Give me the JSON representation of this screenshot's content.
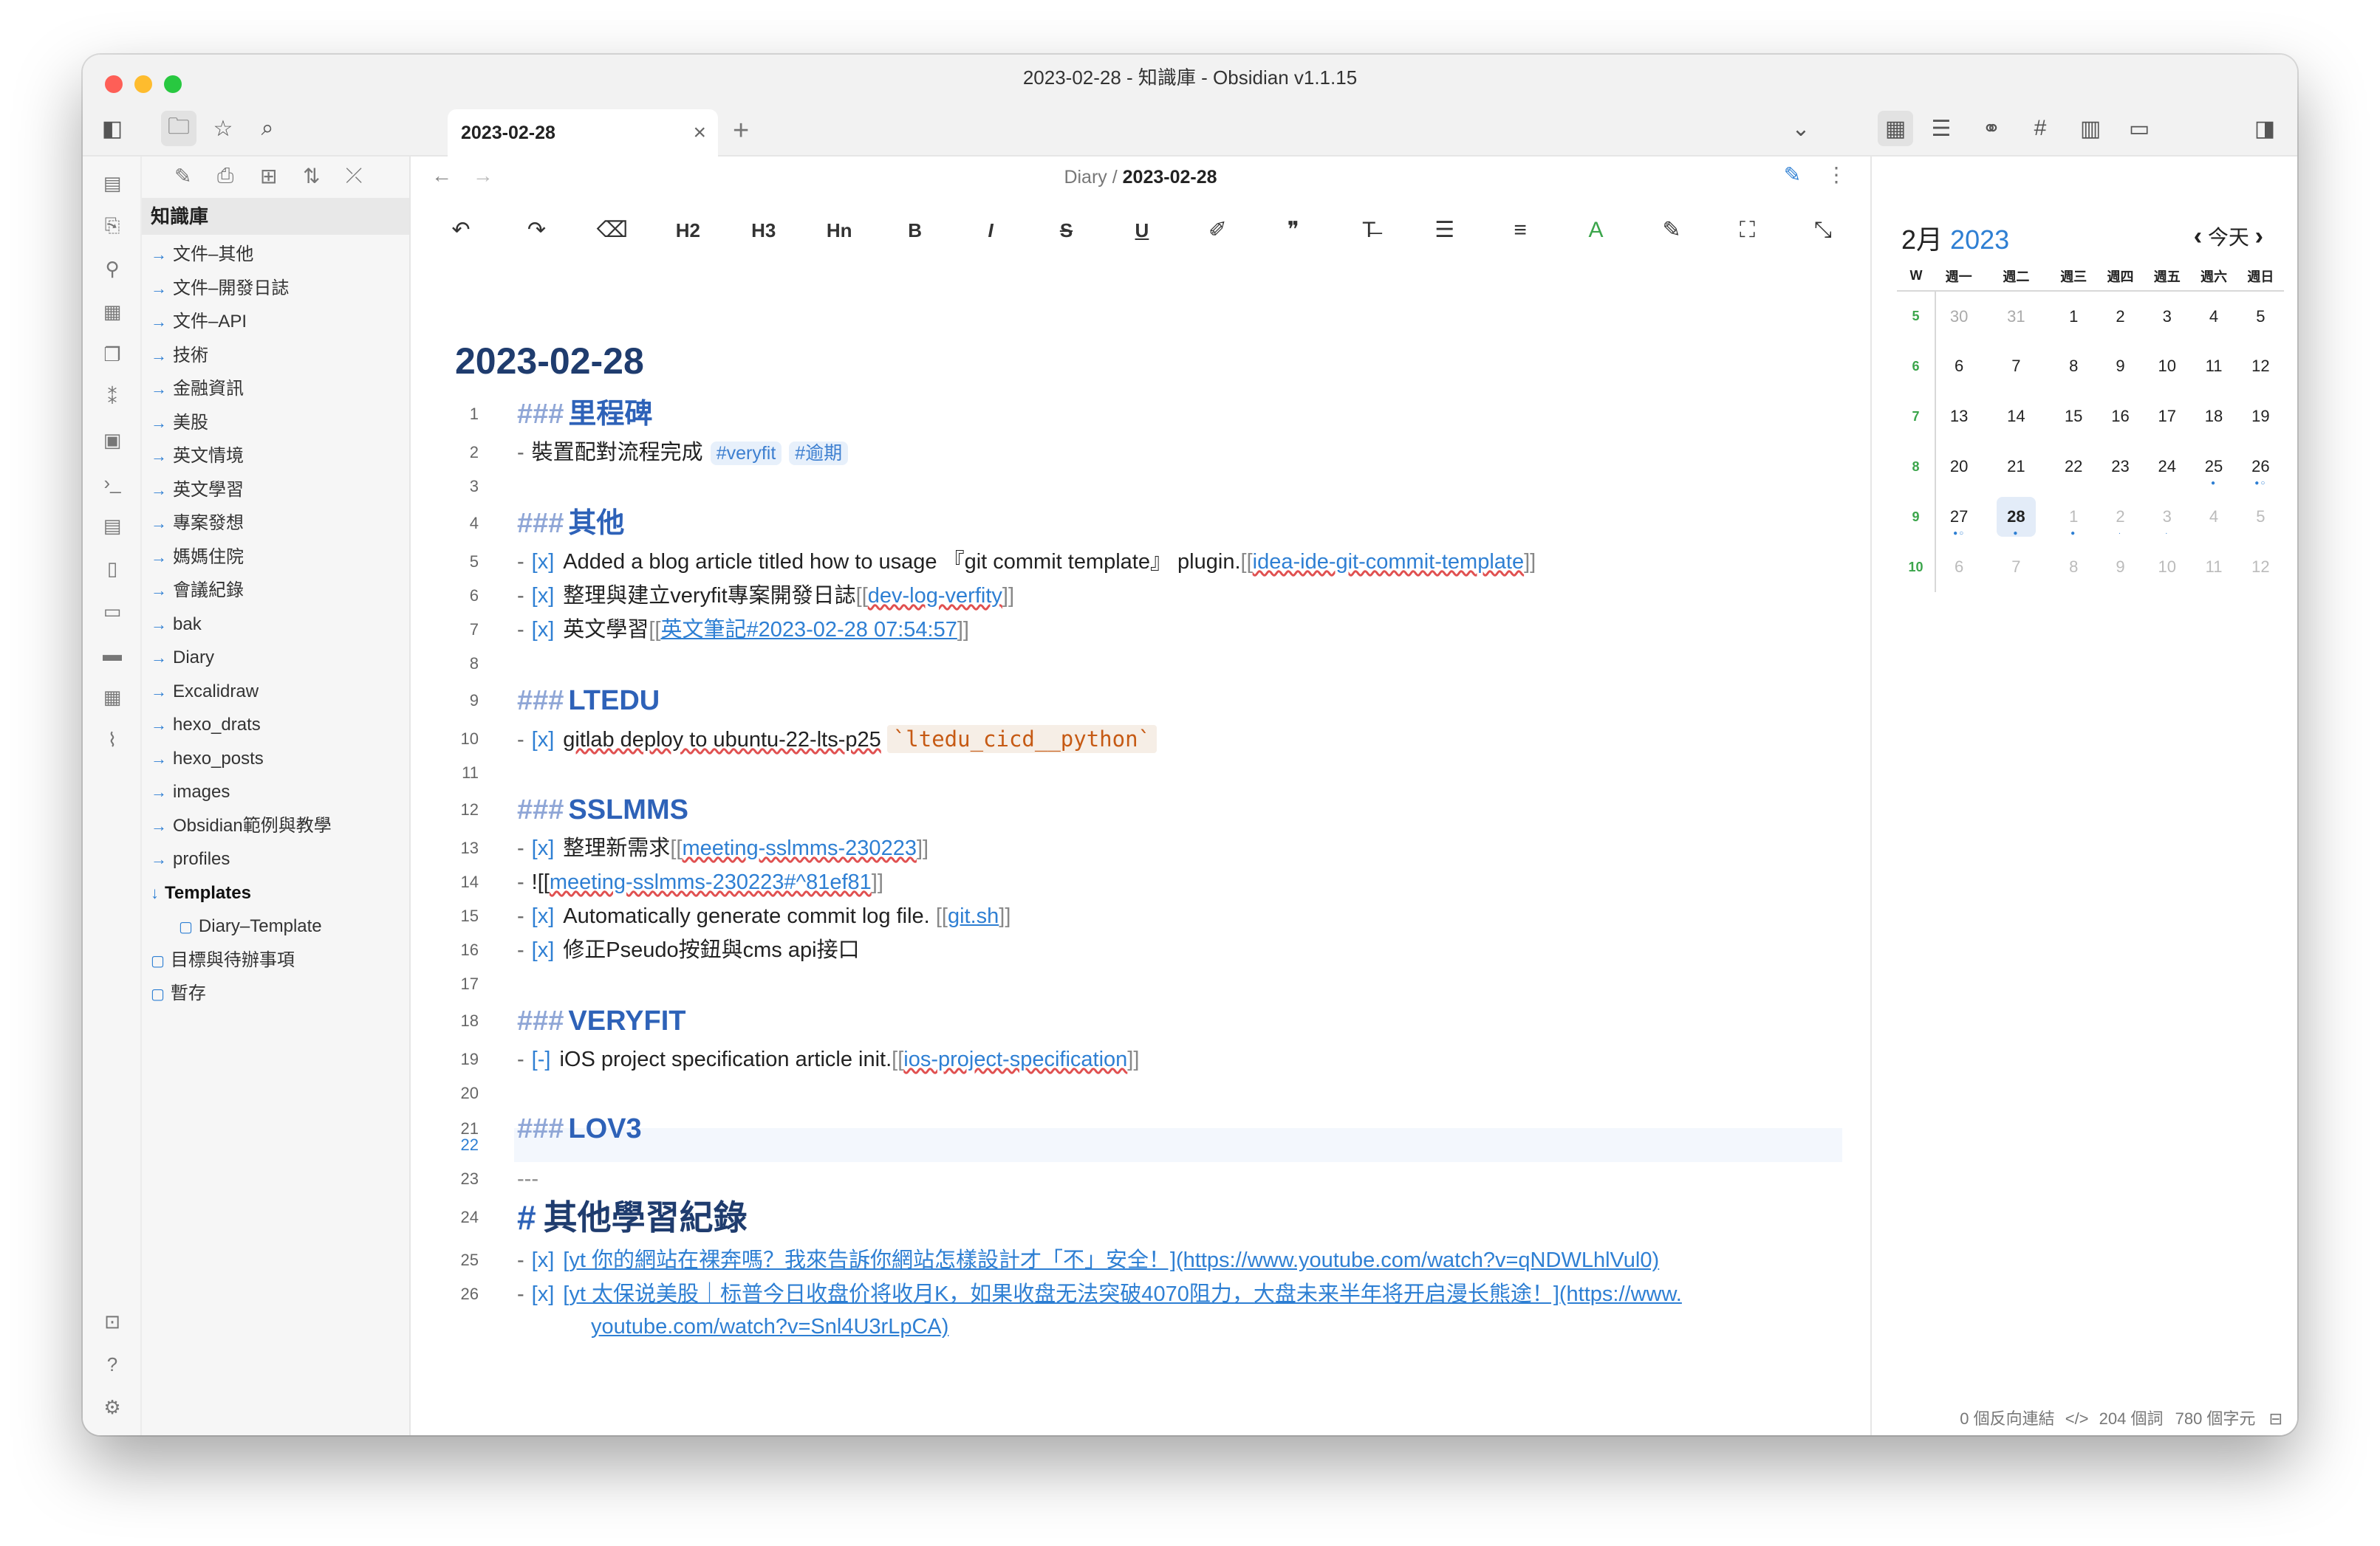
{
  "window": {
    "title": "2023-02-28 - 知識庫 - Obsidian v1.1.15"
  },
  "tab": {
    "label": "2023-02-28",
    "close": "×",
    "new": "+"
  },
  "explorer": {
    "vault": "知識庫",
    "items": [
      {
        "label": "文件–其他",
        "kind": "folder"
      },
      {
        "label": "文件–開發日誌",
        "kind": "folder"
      },
      {
        "label": "文件–API",
        "kind": "folder"
      },
      {
        "label": "技術",
        "kind": "folder"
      },
      {
        "label": "金融資訊",
        "kind": "folder"
      },
      {
        "label": "美股",
        "kind": "folder"
      },
      {
        "label": "英文情境",
        "kind": "folder"
      },
      {
        "label": "英文學習",
        "kind": "folder"
      },
      {
        "label": "專案發想",
        "kind": "folder"
      },
      {
        "label": "媽媽住院",
        "kind": "folder"
      },
      {
        "label": "會議紀錄",
        "kind": "folder"
      },
      {
        "label": "bak",
        "kind": "folder"
      },
      {
        "label": "Diary",
        "kind": "folder"
      },
      {
        "label": "Excalidraw",
        "kind": "folder"
      },
      {
        "label": "hexo_drats",
        "kind": "folder"
      },
      {
        "label": "hexo_posts",
        "kind": "folder"
      },
      {
        "label": "images",
        "kind": "folder"
      },
      {
        "label": "Obsidian範例與教學",
        "kind": "folder"
      },
      {
        "label": "profiles",
        "kind": "folder"
      },
      {
        "label": "Templates",
        "kind": "folder-open"
      },
      {
        "label": "Diary–Template",
        "kind": "file-nested"
      },
      {
        "label": "目標與待辦事項",
        "kind": "file"
      },
      {
        "label": "暫存",
        "kind": "file"
      }
    ]
  },
  "breadcrumb": {
    "parent": "Diary",
    "sep": "/",
    "current": "2023-02-28"
  },
  "toolbar": {
    "h2": "H2",
    "h3": "H3",
    "hn": "Hn",
    "bold": "B",
    "italic": "I",
    "strike": "S",
    "underline": "U"
  },
  "doc": {
    "title": "2023-02-28",
    "lines": {
      "n": [
        "1",
        "2",
        "3",
        "4",
        "5",
        "6",
        "7",
        "8",
        "9",
        "10",
        "11",
        "12",
        "13",
        "14",
        "15",
        "16",
        "17",
        "18",
        "19",
        "20",
        "21",
        "22",
        "23",
        "24",
        "25",
        "26"
      ],
      "h_mark": "###",
      "h1_mark": "#",
      "dash": "-",
      "cb_x": "[x]",
      "cb_dash": "[-]",
      "l1": "里程碑",
      "l2_text": "裝置配對流程完成",
      "l2_tag1": "#veryfit",
      "l2_tag2": "#逾期",
      "l4": "其他",
      "l5_text": "Added a blog article titled how to usage 『git commit template』 plugin.",
      "l5_link": "idea-ide-git-commit-template",
      "l6_text": "整理與建立veryfit專案開發日誌",
      "l6_link": "dev-log-verfity",
      "l7_text": "英文學習",
      "l7_link": "英文筆記#2023-02-28 07:54:57",
      "l9": "LTEDU",
      "l10_text": "gitlab deploy to ubuntu-22-lts-p25",
      "l10_code": "`ltedu_cicd__python`",
      "l12": "SSLMMS",
      "l13_text": "整理新需求",
      "l13_link": "meeting-sslmms-230223",
      "l14_prefix": "![[",
      "l14_link": "meeting-sslmms-230223#^81ef81",
      "l15_text": "Automatically generate commit log file.",
      "l15_link": "git.sh",
      "l16_text": "修正Pseudo按鈕與cms api接口",
      "l18": "VERYFIT",
      "l19_text": "iOS project specification article init.",
      "l19_link": "ios-project-specification",
      "l21": "LOV3",
      "l23": "---",
      "l24": "其他學習紀錄",
      "l25_link": "[yt 你的網站在裸奔嗎？我來告訴你網站怎樣設計才「不」安全！](https://www.youtube.com/watch?v=qNDWLhlVul0)",
      "l26_link_a": "[yt 太保说美股｜标普今日收盘价将收月K，如果收盘无法突破4070阻力，大盘未来半年将开启漫长熊途！](https://www.",
      "l26_link_b": "youtube.com/watch?v=Snl4U3rLpCA)"
    }
  },
  "calendar": {
    "month": "2月",
    "year": "2023",
    "today_label": "今天",
    "headers": [
      "W",
      "週一",
      "週二",
      "週三",
      "週四",
      "週五",
      "週六",
      "週日"
    ],
    "rows": [
      [
        "5",
        "30",
        "31",
        "1",
        "2",
        "3",
        "4",
        "5"
      ],
      [
        "6",
        "6",
        "7",
        "8",
        "9",
        "10",
        "11",
        "12"
      ],
      [
        "7",
        "13",
        "14",
        "15",
        "16",
        "17",
        "18",
        "19"
      ],
      [
        "8",
        "20",
        "21",
        "22",
        "23",
        "24",
        "25",
        "26"
      ],
      [
        "9",
        "27",
        "28",
        "1",
        "2",
        "3",
        "4",
        "5"
      ],
      [
        "10",
        "6",
        "7",
        "8",
        "9",
        "10",
        "11",
        "12"
      ]
    ]
  },
  "status": {
    "backlinks": "0 個反向連結",
    "words": "204 個詞",
    "chars": "780 個字元"
  },
  "colors": {
    "accent": "#2e7fd3",
    "heading": "#2e62b8",
    "title": "#1f3c6e",
    "week": "#3ba54b"
  }
}
